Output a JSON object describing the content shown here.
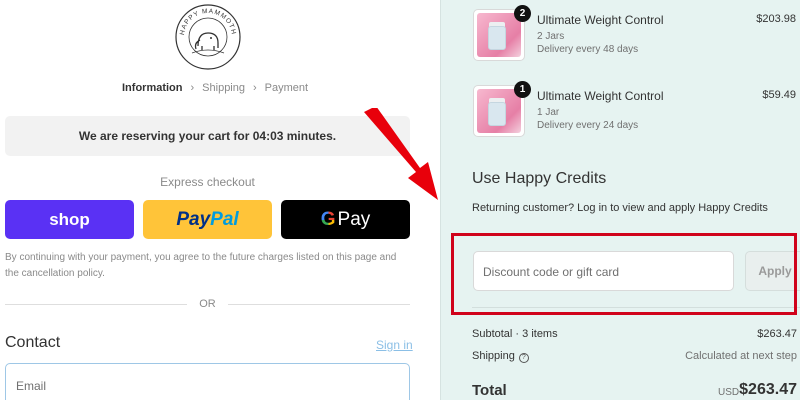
{
  "logo": {
    "text": "HAPPY MAMMOTH",
    "icon": "mammoth-logo"
  },
  "breadcrumb": {
    "items": [
      "Information",
      "Shipping",
      "Payment"
    ],
    "active_index": 0
  },
  "reservation": {
    "text": "We are reserving your cart for 04:03 minutes."
  },
  "express": {
    "title": "Express checkout",
    "shop_label": "shop",
    "paypal_label_1": "Pay",
    "paypal_label_2": "Pal",
    "gpay_g": "G",
    "gpay_label": "Pay",
    "colors": {
      "shop": "#5a31f4",
      "paypal": "#ffc439",
      "gpay": "#000000"
    }
  },
  "disclaimer": "By continuing with your payment, you agree to the future charges listed on this page and the cancellation policy.",
  "divider_label": "OR",
  "contact": {
    "title": "Contact",
    "signin_label": "Sign in",
    "email_placeholder": "Email"
  },
  "cart": {
    "items": [
      {
        "name": "Ultimate Weight Control",
        "variant": "2 Jars",
        "delivery": "Delivery every 48 days",
        "price": "$203.98",
        "quantity": "2"
      },
      {
        "name": "Ultimate Weight Control",
        "variant": "1 Jar",
        "delivery": "Delivery every 24 days",
        "price": "$59.49",
        "quantity": "1"
      }
    ]
  },
  "credits": {
    "title": "Use Happy Credits",
    "text": "Returning customer? Log in to view and apply Happy Credits"
  },
  "discount": {
    "placeholder": "Discount code or gift card",
    "apply_label": "Apply"
  },
  "summary": {
    "subtotal_label": "Subtotal · 3 items",
    "subtotal_value": "$263.47",
    "shipping_label": "Shipping",
    "shipping_value": "Calculated at next step",
    "total_label": "Total",
    "currency": "USD",
    "total_value": "$263.47"
  },
  "annotations": {
    "highlight_color": "#d0021b",
    "arrow_color": "#e8000b"
  }
}
